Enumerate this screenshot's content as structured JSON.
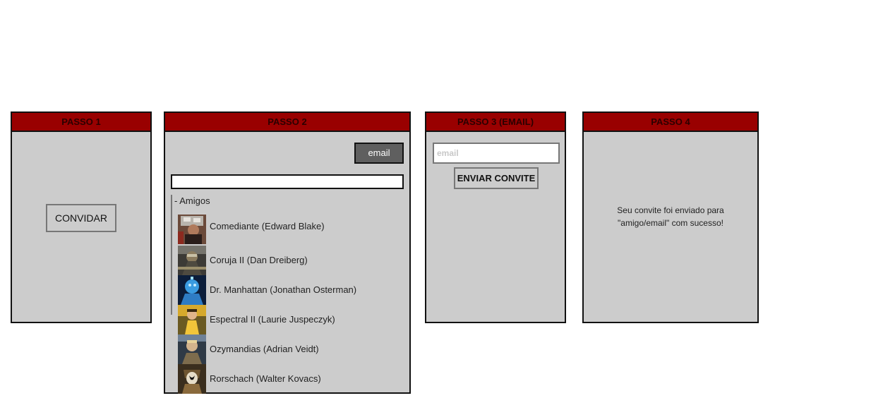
{
  "step1": {
    "header": "PASSO 1",
    "invite_button": "CONVIDAR"
  },
  "step2": {
    "header": "PASSO 2",
    "email_button": "email",
    "search_value": "",
    "group_label": "- Amigos",
    "friends": [
      {
        "name": "Comediante (Edward Blake)",
        "avatar": "comedian-avatar"
      },
      {
        "name": "Coruja II (Dan Dreiberg)",
        "avatar": "nite-owl-avatar"
      },
      {
        "name": "Dr. Manhattan (Jonathan Osterman)",
        "avatar": "dr-manhattan-avatar"
      },
      {
        "name": "Espectral II (Laurie Juspeczyk)",
        "avatar": "silk-spectre-avatar"
      },
      {
        "name": "Ozymandias (Adrian Veidt)",
        "avatar": "ozymandias-avatar"
      },
      {
        "name": "Rorschach (Walter Kovacs)",
        "avatar": "rorschach-avatar"
      }
    ]
  },
  "step3": {
    "header": "PASSO 3 (EMAIL)",
    "email_placeholder": "email",
    "send_button": "ENVIAR CONVITE"
  },
  "step4": {
    "header": "PASSO 4",
    "message_line1": "Seu convite foi enviado para",
    "message_line2": "\"amigo/email\" com sucesso!"
  },
  "colors": {
    "header_bg": "#990000",
    "panel_bg": "#cccccc",
    "border": "#111111",
    "email_button_bg": "#5f5f5f"
  }
}
